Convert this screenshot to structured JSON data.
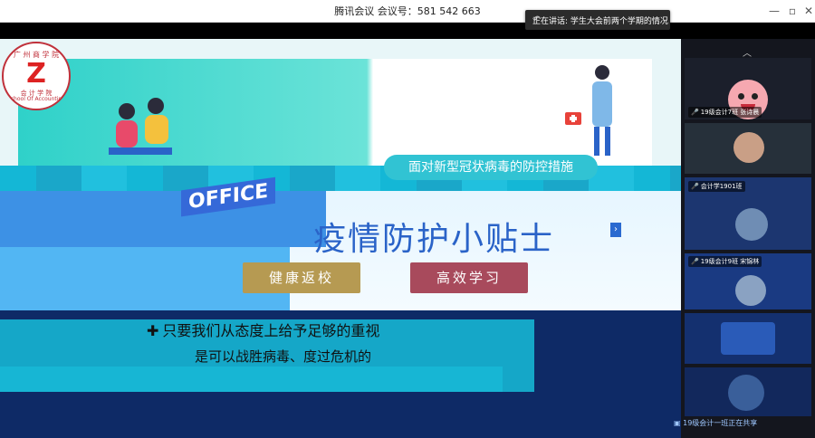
{
  "window": {
    "title": "腾讯会议  会议号：581 542 663",
    "controls": [
      "minimize",
      "maximize",
      "close"
    ]
  },
  "notification": {
    "text": "正在讲话: 学生大会前两个学期的情况",
    "undo_icon": "undo-icon"
  },
  "slide": {
    "logo": {
      "top_text": "广 州 商 学 院",
      "center_text": "Z",
      "bottom_text": "会 计 学 院",
      "bottom_en": "School Of Accounting"
    },
    "banner_text": "OFFICE",
    "subtitle": "面对新型冠状病毒的防控措施",
    "title": "疫情防护小贴士",
    "buttons": [
      {
        "label": "健康返校",
        "color": "#b69a52"
      },
      {
        "label": "高效学习",
        "color": "#a84a5c"
      }
    ],
    "tips": [
      {
        "icon": "cross-icon",
        "text": "只要我们从态度上给予足够的重视"
      },
      {
        "text": "是可以战胜病毒、度过危机的"
      }
    ]
  },
  "participants": [
    {
      "name": "19级会计7班 张诗晨",
      "type": "avatar"
    },
    {
      "name": "",
      "type": "photo"
    },
    {
      "name": "会计学1901班",
      "type": "photo"
    },
    {
      "name": "19级会计9班 宋锦林",
      "type": "photo"
    },
    {
      "name": "",
      "type": "photo"
    },
    {
      "name": "",
      "type": "photo"
    }
  ],
  "footer": {
    "text": "19级会计一班正在共享"
  },
  "colors": {
    "accent_blue": "#2a63c8",
    "teal": "#31c3d3"
  }
}
